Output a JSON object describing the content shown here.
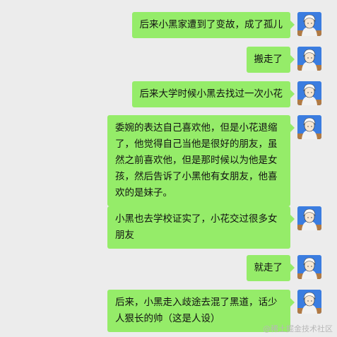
{
  "messages": [
    {
      "text": "后来小黑家遭到了变故，成了孤儿"
    },
    {
      "text": "搬走了"
    },
    {
      "text": "后来大学时候小黑去找过一次小花"
    },
    {
      "text": "委婉的表达自己喜欢他，但是小花退缩了，他觉得自己当他是很好的朋友，虽然之前喜欢他，但是那时候以为他是女孩，然后告诉了小黑他有女朋友，他喜欢的是妹子。"
    },
    {
      "text": "小黑也去学校证实了，小花交过很多女朋友"
    },
    {
      "text": "就走了"
    },
    {
      "text": "后来，小黑走入歧途去混了黑道，话少人狠长的帅（这是人设）"
    }
  ],
  "watermark": "@稀土掘金技术社区",
  "colors": {
    "bubble": "#95ec69",
    "background": "#ececec",
    "avatar": "#3b7de0"
  }
}
